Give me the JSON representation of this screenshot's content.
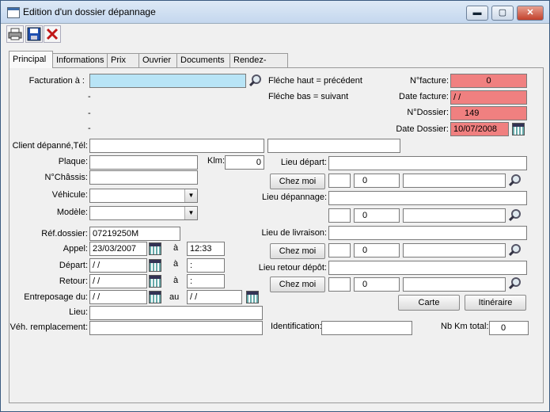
{
  "window": {
    "title": "Edition d'un dossier dépannage",
    "minimize": "▬",
    "maximize": "▢",
    "close": "✕"
  },
  "toolbar": {
    "print_icon": "printer-icon",
    "save_icon": "save-icon",
    "delete_icon": "delete-icon"
  },
  "tabs": [
    {
      "label": "Principal",
      "active": true
    },
    {
      "label": "Informations"
    },
    {
      "label": "Prix"
    },
    {
      "label": "Ouvrier"
    },
    {
      "label": "Documents"
    },
    {
      "label": "Rendez-vous"
    }
  ],
  "form": {
    "facturation_label": "Facturation à :",
    "facturation_value": "",
    "dash1": "-",
    "dash2": "-",
    "dash3": "-",
    "hint_up": "Fléche haut = précédent",
    "hint_down": "Fléche bas = suivant",
    "nfacture_label": "N°facture:",
    "nfacture_value": "0",
    "datefacture_label": "Date facture:",
    "datefacture_value": " / /",
    "ndossier_label": "N°Dossier:",
    "ndossier_value": "149",
    "datedossier_label": "Date Dossier:",
    "datedossier_value": "10/07/2008",
    "client_label": "Client dépanné,Tél:",
    "client_value": "",
    "tel_value": "",
    "plaque_label": "Plaque:",
    "plaque_value": "",
    "klm_label": "Klm:",
    "klm_value": "0",
    "chassis_label": "N°Châssis:",
    "chassis_value": "",
    "vehicule_label": "Véhicule:",
    "vehicule_value": "",
    "modele_label": "Modèle:",
    "modele_value": "",
    "refdossier_label": "Réf.dossier:",
    "refdossier_value": "07219250M",
    "appel_label": "Appel:",
    "appel_date": "23/03/2007",
    "appel_a": "à",
    "appel_time": "12:33",
    "depart_label": "Départ:",
    "depart_date": " / /",
    "depart_a": "à",
    "depart_time": " :",
    "retour_label": "Retour:",
    "retour_date": " / /",
    "retour_a": "à",
    "retour_time": " :",
    "entreposage_label": "Entreposage du:",
    "entreposage_from": " / /",
    "entreposage_au": "au",
    "entreposage_to": " / /",
    "lieu_label": "Lieu:",
    "lieu_value": "",
    "vehrempl_label": "Véh. remplacement:",
    "vehrempl_value": "",
    "lieudepart_label": "Lieu départ:",
    "lieudepart_value": "",
    "chezmoi1": "Chez moi",
    "depart_code": "",
    "depart_num": "0",
    "depart_city": "",
    "lieudepannage_label": "Lieu dépannage:",
    "lieudepannage_value": "",
    "depannage_code": "",
    "depannage_num": "0",
    "depannage_city": "",
    "lieulivraison_label": "Lieu de livraison:",
    "lieulivraison_value": "",
    "chezmoi2": "Chez moi",
    "livraison_code": "",
    "livraison_num": "0",
    "livraison_city": "",
    "lieuretour_label": "Lieu retour dépôt:",
    "lieuretour_value": "",
    "chezmoi3": "Chez moi",
    "retour_code": "",
    "retour_num": "0",
    "retour_city": "",
    "carte_button": "Carte",
    "itineraire_button": "Itinéraire",
    "identification_label": "Identification:",
    "identification_value": "",
    "nbkm_label": "Nb Km total:",
    "nbkm_value": "0"
  }
}
